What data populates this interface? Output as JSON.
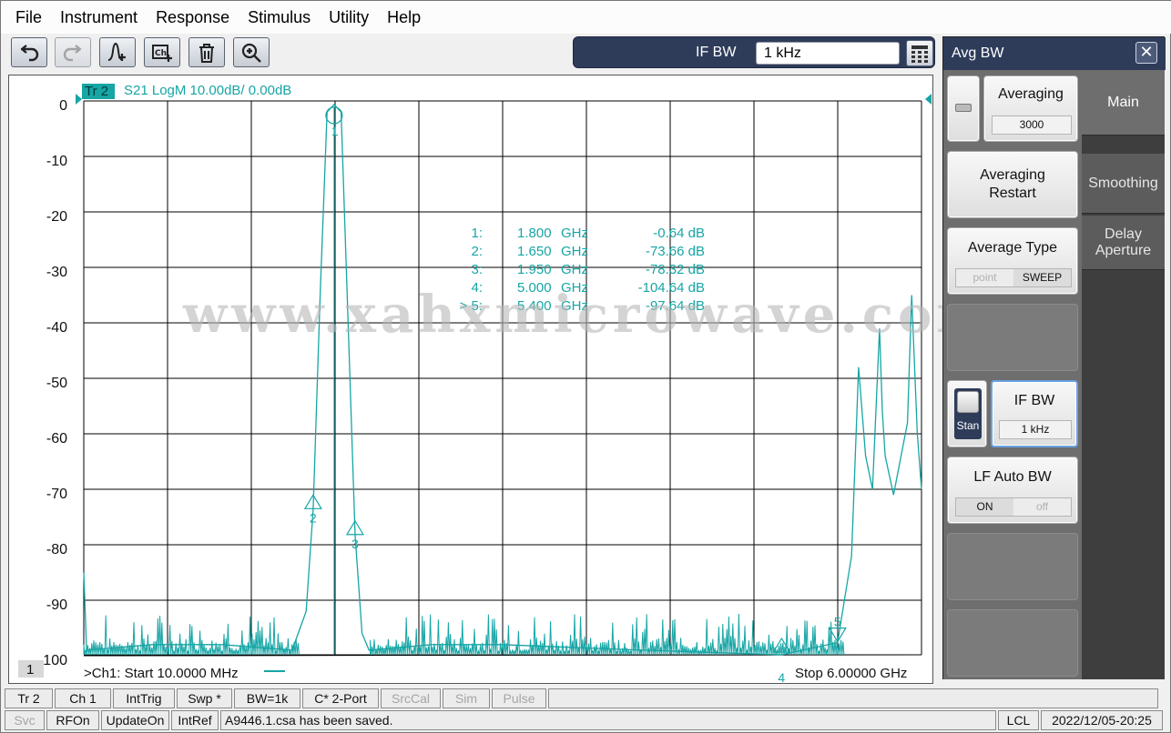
{
  "menubar": {
    "items": [
      "File",
      "Instrument",
      "Response",
      "Stimulus",
      "Utility",
      "Help"
    ]
  },
  "toolbar": {
    "buttons": [
      {
        "name": "undo-button",
        "icon": "undo-icon"
      },
      {
        "name": "redo-button",
        "icon": "redo-icon",
        "disabled": true
      },
      {
        "name": "add-marker-button",
        "icon": "marker-add-icon"
      },
      {
        "name": "add-channel-button",
        "icon": "channel-add-icon"
      },
      {
        "name": "delete-button",
        "icon": "trash-icon"
      },
      {
        "name": "zoom-button",
        "icon": "zoom-in-icon"
      }
    ],
    "ifbw": {
      "label": "IF BW",
      "value": "1 kHz"
    }
  },
  "trace": {
    "tag": "Tr 2",
    "header": "S21 LogM 10.00dB/  0.00dB",
    "color": "#17a5a5",
    "channel_number": "1",
    "start_label": ">Ch1:  Start   10.0000 MHz",
    "stop_label": "Stop  6.00000 GHz"
  },
  "chart_data": {
    "type": "line",
    "xlabel": "",
    "ylabel": "",
    "x_start_ghz": 0.01,
    "x_stop_ghz": 6.0,
    "ylim": [
      -100,
      0
    ],
    "yticks": [
      "0",
      "-10",
      "-20",
      "-30",
      "-40",
      "-50",
      "-60",
      "-70",
      "-80",
      "-90",
      "-100"
    ],
    "grid": true,
    "series": [
      {
        "x_ghz": [
          0.01,
          0.03,
          0.5,
          1.0,
          1.5,
          1.6,
          1.65,
          1.7,
          1.75,
          1.8,
          1.85,
          1.9,
          1.95,
          2.0,
          2.05,
          2.5,
          3.0,
          4.0,
          5.0,
          5.4,
          5.5,
          5.55,
          5.6,
          5.65,
          5.7,
          5.72,
          5.74,
          5.8,
          5.9,
          5.93,
          5.97,
          6.0
        ],
        "y_db": [
          -85,
          -99,
          -98,
          -98,
          -99,
          -92,
          -73.66,
          -35,
          -2,
          -0.64,
          -2,
          -40,
          -78.32,
          -96,
          -99,
          -98,
          -98,
          -99,
          -104.64,
          -97.64,
          -82,
          -48,
          -64,
          -70,
          -41,
          -56,
          -64,
          -71,
          -58,
          -35,
          -60,
          -70
        ]
      }
    ],
    "markers": [
      {
        "id": "1",
        "freq": "1.800",
        "unit": "GHz",
        "value": "-0.64 dB",
        "x_ghz": 1.8,
        "y_db": -0.64
      },
      {
        "id": "2",
        "freq": "1.650",
        "unit": "GHz",
        "value": "-73.66 dB",
        "x_ghz": 1.65,
        "y_db": -73.66
      },
      {
        "id": "3",
        "freq": "1.950",
        "unit": "GHz",
        "value": "-78.32 dB",
        "x_ghz": 1.95,
        "y_db": -78.32
      },
      {
        "id": "4",
        "freq": "5.000",
        "unit": "GHz",
        "value": "-104.64 dB",
        "x_ghz": 5.0,
        "y_db": -104.64
      },
      {
        "id": "5",
        "freq": "5.400",
        "unit": "GHz",
        "value": "-97.64 dB",
        "x_ghz": 5.4,
        "y_db": -97.64,
        "active": true
      }
    ]
  },
  "watermark": "www.xahxmicrowave.com",
  "softkeys": {
    "title": "Avg BW",
    "close_icon": "close-icon",
    "tabs": [
      "Main",
      "Smoothing",
      "Delay Aperture"
    ],
    "averaging": {
      "label": "Averaging",
      "value": "3000"
    },
    "averaging_restart": {
      "line1": "Averaging",
      "line2": "Restart"
    },
    "average_type": {
      "label": "Average Type",
      "options": [
        "point",
        "SWEEP"
      ],
      "selected": "SWEEP"
    },
    "stan": {
      "label": "Stan"
    },
    "ifbw": {
      "label": "IF BW",
      "value": "1 kHz"
    },
    "lf_auto_bw": {
      "label": "LF Auto BW",
      "options": [
        "ON",
        "off"
      ],
      "selected": "ON"
    }
  },
  "statusbar": {
    "row1": [
      "Tr 2",
      "Ch 1",
      "IntTrig",
      "Swp *",
      "BW=1k",
      "C* 2-Port",
      "SrcCal",
      "Sim",
      "Pulse"
    ],
    "row1_disabled": [
      "SrcCal",
      "Sim",
      "Pulse"
    ],
    "row2": [
      "Svc",
      "RFOn",
      "UpdateOn",
      "IntRef"
    ],
    "row2_disabled": [
      "Svc"
    ],
    "message": "A9446.1.csa has been saved.",
    "lcl": "LCL",
    "datetime": "2022/12/05-20:25"
  }
}
